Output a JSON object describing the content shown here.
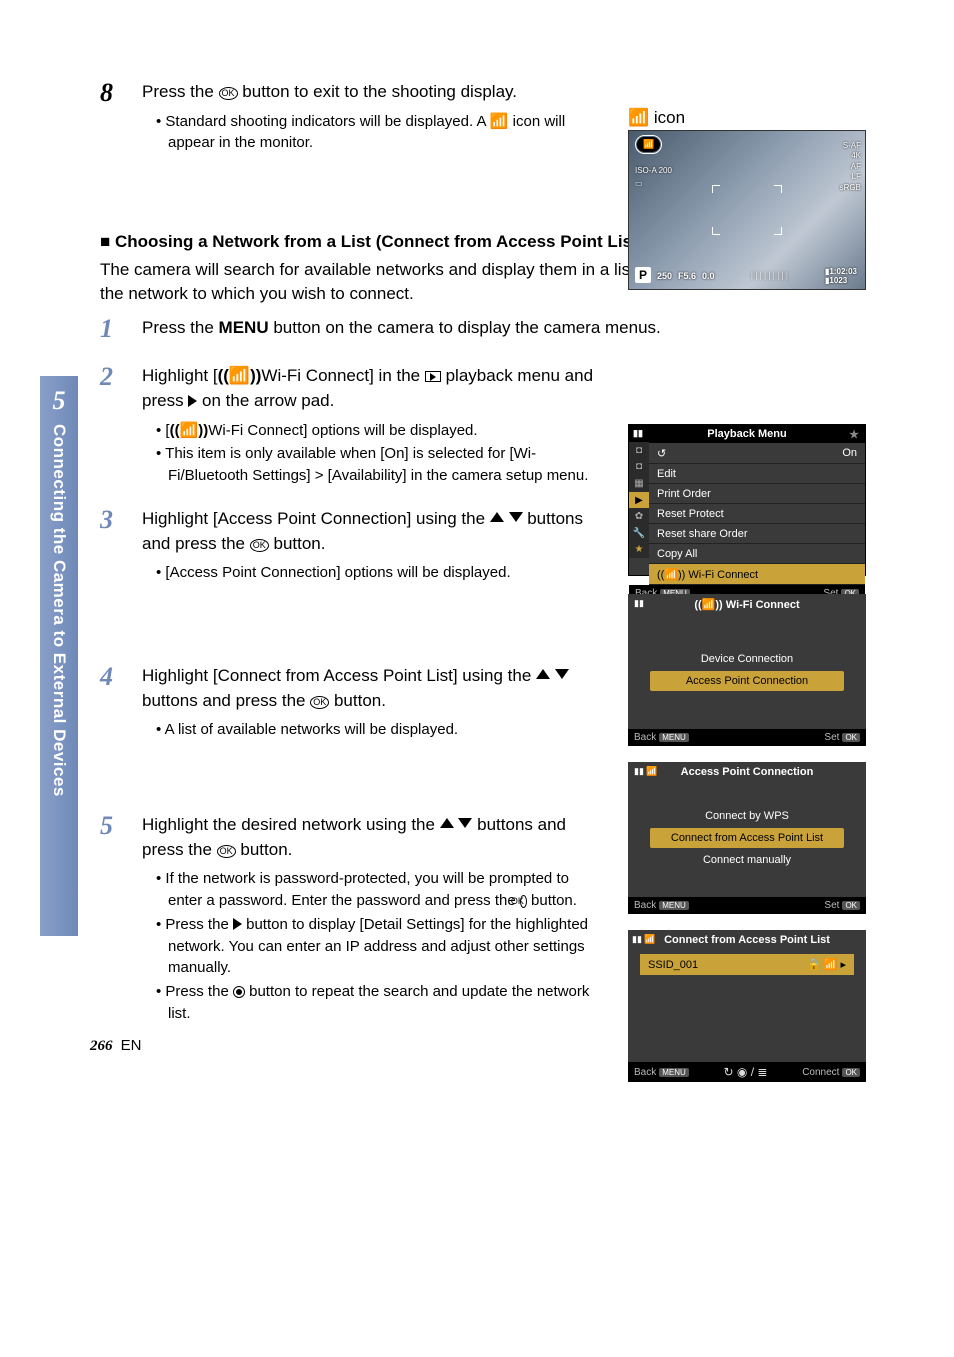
{
  "chapter": {
    "number": "5",
    "title": "Connecting the Camera to External Devices"
  },
  "step8": {
    "num": "8",
    "main": [
      "Press the ",
      " button to exit to the shooting display."
    ],
    "bullet": [
      "Standard shooting indicators will be displayed. A ",
      " icon will appear in the monitor."
    ],
    "iconLabel": " icon"
  },
  "shootingDisplay": {
    "wifiBadge": "((📶))",
    "pBadge": "P",
    "bottom": {
      "shutter": "250",
      "aperture": "F5.6",
      "ev": "0.0"
    },
    "rightStack": [
      "S-AF",
      "4K",
      "AF",
      "LF",
      "sRGB"
    ],
    "leftStack": [
      "ISO-A\n200",
      "▭"
    ],
    "clock": "1:02:03",
    "shots": "1023"
  },
  "section": {
    "head": "Choosing a Network from a List (Connect from Access Point List)",
    "intro": "The camera will search for available networks and display them in a list from which you can choose the network to which you wish to connect."
  },
  "step1": {
    "num": "1",
    "main": [
      "Press the ",
      "MENU",
      " button on the camera to display the camera menus."
    ]
  },
  "step2": {
    "num": "2",
    "mainA": "Highlight [",
    "mainB": "Wi-Fi Connect] in the ",
    "mainC": " playback menu and press ",
    "mainD": " on the arrow pad.",
    "bullets": [
      "Wi-Fi Connect] options will be displayed.",
      "This item is only available when [On] is selected for [Wi-Fi/Bluetooth Settings] > [Availability] in the camera  setup menu."
    ],
    "bullet1Prefix": "[",
    "wrench": "🔧"
  },
  "playbackMenu": {
    "title": "Playback Menu",
    "items": [
      {
        "icon": "↺",
        "label": "",
        "value": "On"
      },
      {
        "label": "Edit"
      },
      {
        "label": "Print Order"
      },
      {
        "label": "Reset Protect"
      },
      {
        "label": "Reset share Order"
      },
      {
        "label": "Copy All"
      },
      {
        "label": "Wi-Fi Connect",
        "hl": true,
        "prefix": "((📶))"
      }
    ],
    "back": "Back",
    "backBtn": "MENU",
    "set": "Set",
    "setBtn": "OK"
  },
  "step3": {
    "num": "3",
    "main": [
      "Highlight [Access Point Connection] using the ",
      " buttons and press the ",
      " button."
    ],
    "bullet": "[Access Point Connection] options will be displayed."
  },
  "wifiConnectScreen": {
    "title": "Wi-Fi Connect",
    "prefix": "((📶))",
    "opts": [
      "Device Connection",
      "Access Point Connection"
    ],
    "hlIndex": 1,
    "back": "Back",
    "backBtn": "MENU",
    "set": "Set",
    "setBtn": "OK"
  },
  "step4": {
    "num": "4",
    "main": [
      "Highlight [Connect from Access Point List] using the ",
      " buttons and press the ",
      " button."
    ],
    "bullet": "A list of available networks will be displayed."
  },
  "apConnScreen": {
    "title": "Access Point Connection",
    "opts": [
      "Connect by WPS",
      "Connect from Access Point List",
      "Connect manually"
    ],
    "hlIndex": 1,
    "back": "Back",
    "backBtn": "MENU",
    "set": "Set",
    "setBtn": "OK"
  },
  "step5": {
    "num": "5",
    "main": [
      "Highlight the desired network using the ",
      " buttons and press the ",
      " button."
    ],
    "bullets": [
      "If the network is password-protected, you will be prompted to enter a password. Enter the password and press the  button.",
      "Press the  button to display [Detail Settings] for the highlighted network. You can enter an IP address and adjust other settings manually.",
      "Press the  button to repeat the search and update the network list."
    ]
  },
  "networkListScreen": {
    "title": "Connect from Access Point List",
    "ssid": "SSID_001",
    "back": "Back",
    "backBtn": "MENU",
    "mid": "↻ ◉ / ≣",
    "connect": "Connect",
    "connectBtn": "OK"
  },
  "footer": {
    "page": "266",
    "lang": "EN"
  }
}
